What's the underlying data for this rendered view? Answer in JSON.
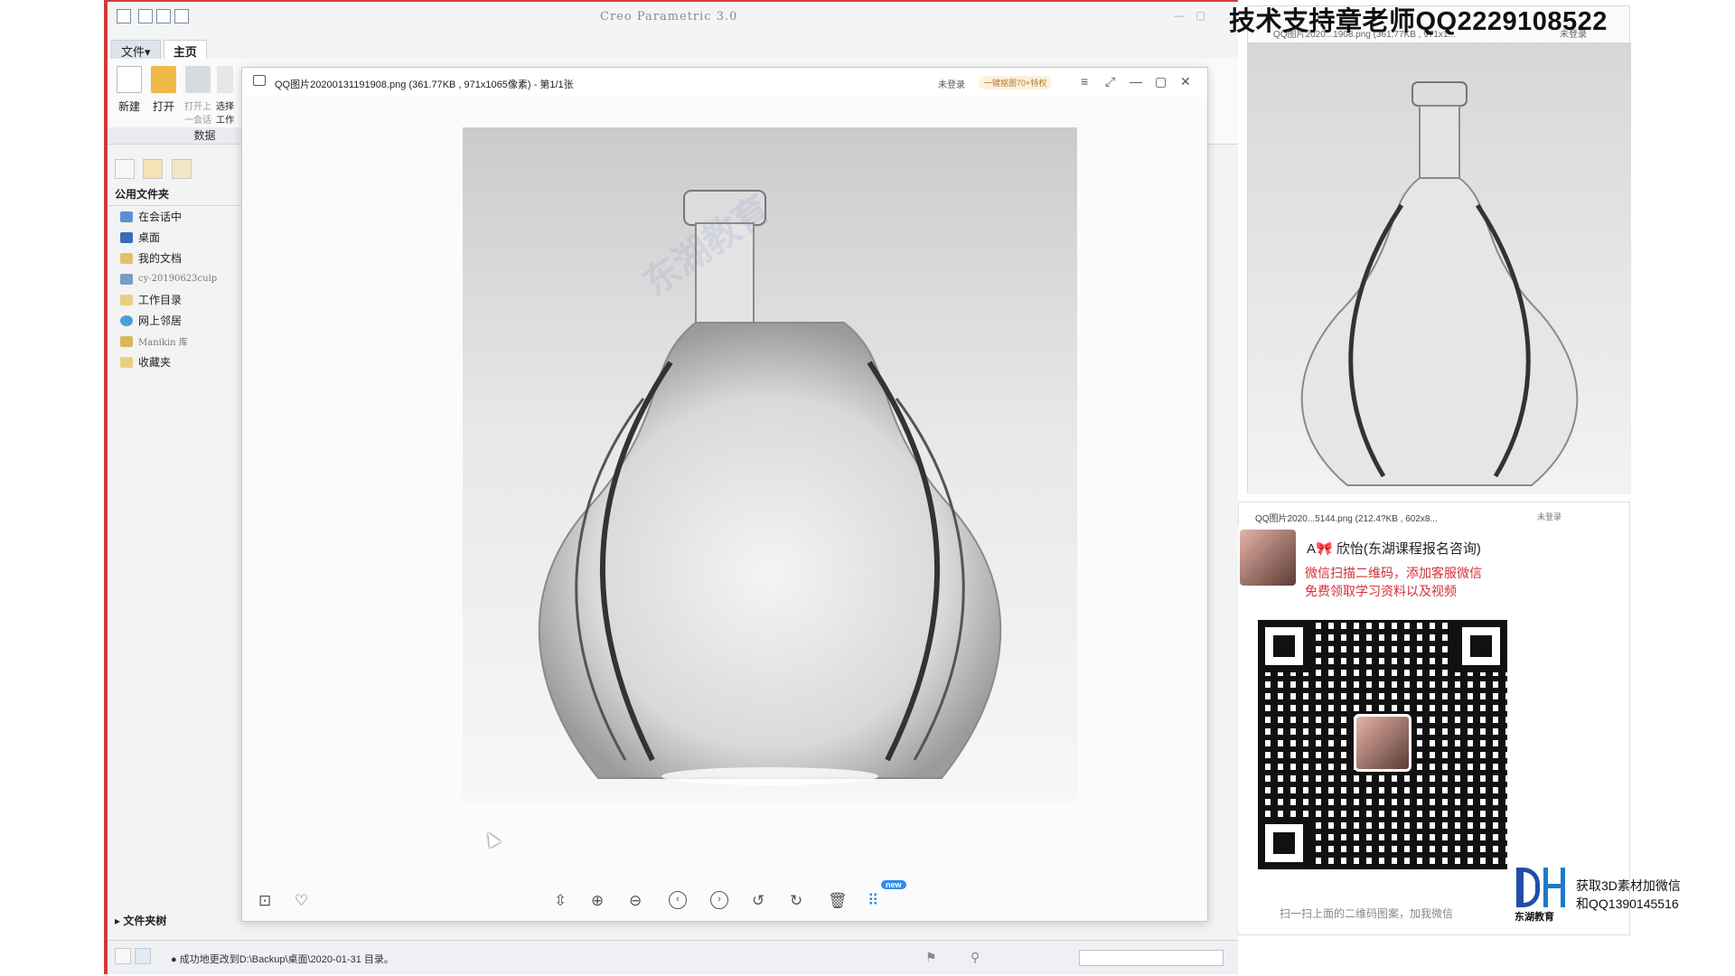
{
  "creo": {
    "title": "Creo Parametric 3.0",
    "tabs": [
      "文件▾",
      "主页"
    ],
    "ribbon_buttons": [
      "新建",
      "打开",
      "打开上一会话",
      "选择工作"
    ],
    "ribbon_group": "数据",
    "folder_header": "公用文件夹",
    "folders": [
      "在会话中",
      "桌面",
      "我的文档",
      "cy-20190623culp",
      "工作目录",
      "网上邻居",
      "Manikin 库",
      "收藏夹"
    ],
    "tree_toggle": "▸ 文件夹树",
    "status_message": "● 成功地更改到D:\\Backup\\桌面\\2020-01-31 目录。"
  },
  "viewer": {
    "title": "QQ图片20200131191908.png (361.77KB , 971x1065像素) - 第1/1张",
    "login": "未登录",
    "badge": "一键抠图70+特权",
    "controls": [
      "≡",
      "⤢",
      "—",
      "▢",
      "✕"
    ],
    "toolbar": [
      "⊡",
      "♡",
      "⇳",
      "⊕",
      "⊖",
      "‹",
      "›",
      "↺",
      "↻",
      "🗑",
      "⠿"
    ],
    "new_badge": "new"
  },
  "right_top": {
    "caption": "QQ图片2020...1908.png (361.77KB , 971x1...",
    "login": "未登录"
  },
  "support_text": "技术支持章老师QQ2229108522",
  "right_bottom": {
    "caption": "QQ图片2020...5144.png (212.4?KB , 602x8...",
    "login": "未登录"
  },
  "contact": {
    "name": "A🎀 欣怡(东湖课程报名咨询)",
    "line1": "微信扫描二维码，添加客服微信",
    "line2": "免费领取学习资料以及视频",
    "qr_caption": "扫一扫上面的二维码图案，加我微信"
  },
  "promo": {
    "logo_text": "东湖教育",
    "line1": "获取3D素材加微信",
    "line2": "和QQ1390145516"
  },
  "watermark": "东湖教育",
  "colors": {
    "accent_red": "#d23a3a",
    "contact_red": "#d2303a",
    "brand_blue": "#1f4fa8"
  }
}
